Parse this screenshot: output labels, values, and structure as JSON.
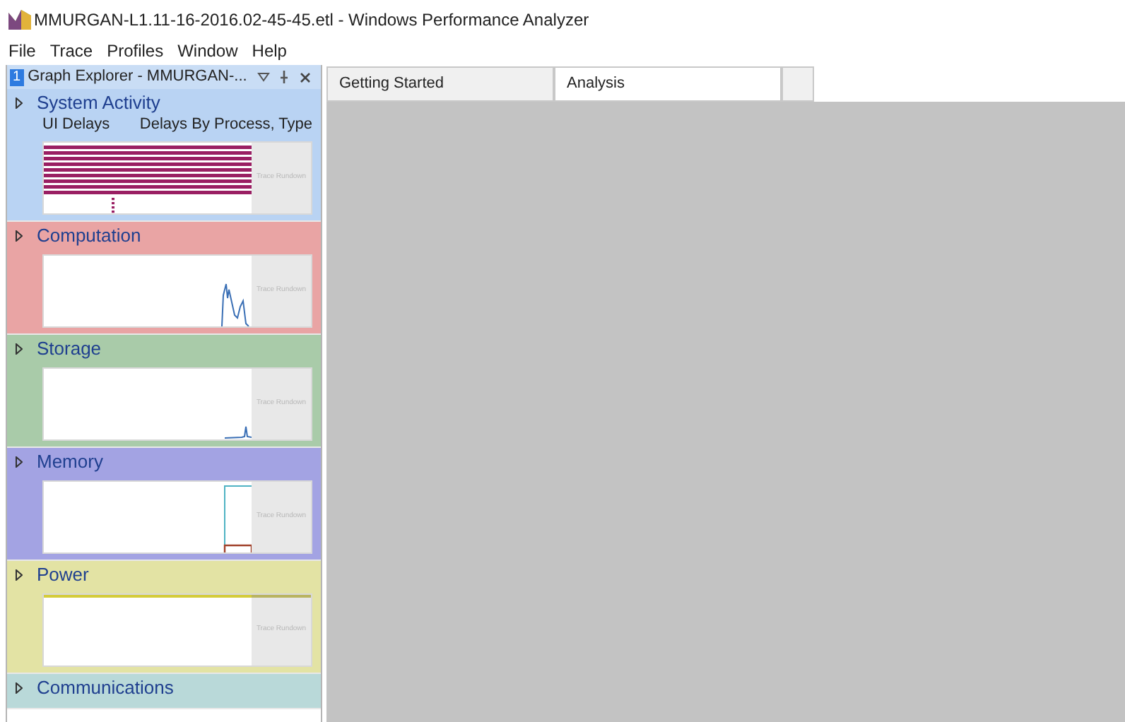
{
  "window": {
    "title": "MMURGAN-L1.11-16-2016.02-45-45.etl - Windows Performance Analyzer"
  },
  "menu": [
    "File",
    "Trace",
    "Profiles",
    "Window",
    "Help"
  ],
  "graph_explorer": {
    "number": "1",
    "title": "Graph Explorer - MMURGAN-...",
    "sections": [
      {
        "title": "System Activity",
        "color": "#b9d3f3",
        "labels": [
          "UI Delays",
          "Delays By Process, Type"
        ],
        "kind": "bars",
        "rundown": "Trace Rundown"
      },
      {
        "title": "Computation",
        "color": "#e9a4a4",
        "kind": "spikes",
        "rundown": "Trace Rundown"
      },
      {
        "title": "Storage",
        "color": "#a9cba9",
        "kind": "flat",
        "rundown": "Trace Rundown"
      },
      {
        "title": "Memory",
        "color": "#a3a3e3",
        "kind": "steps",
        "rundown": "Trace Rundown"
      },
      {
        "title": "Power",
        "color": "#e3e3a4",
        "kind": "line",
        "rundown": "Trace Rundown"
      },
      {
        "title": "Communications",
        "color": "#b9d9d9",
        "kind": "none"
      }
    ]
  },
  "tabs": [
    {
      "label": "Getting Started",
      "selected": false
    },
    {
      "label": "Analysis",
      "selected": true
    },
    {
      "selected": false
    }
  ]
}
